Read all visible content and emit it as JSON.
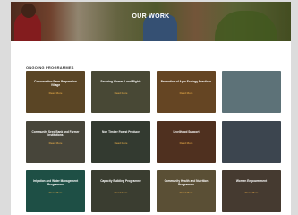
{
  "hero": {
    "title": "OUR WORK"
  },
  "section": {
    "title": "ONGOING PROGRAMMES"
  },
  "cards": [
    {
      "title": "Conservation Farm Preparation Village",
      "sub": "Read More",
      "bg": "#8a6a3a"
    },
    {
      "title": "Securing Women Land Rights",
      "sub": "Read More",
      "bg": "#6f6f52"
    },
    {
      "title": "Promotion of Agro Ecology Practices",
      "sub": "Read More",
      "bg": "#9c6b36"
    },
    {
      "title": "",
      "sub": "",
      "bg": "#8fb0b8"
    },
    {
      "title": "Community Seed Bank and Farmer Institutions",
      "sub": "Read More",
      "bg": "#6e6a5a"
    },
    {
      "title": "Non Timber Forest Produce",
      "sub": "Read More",
      "bg": "#4f5a4a"
    },
    {
      "title": "Livelihood Support",
      "sub": "Read More",
      "bg": "#7a4a30"
    },
    {
      "title": "",
      "sub": "",
      "bg": "#5d6a7a"
    },
    {
      "title": "Irrigation and Water Management Programme",
      "sub": "Read More",
      "bg": "#2f7a6a"
    },
    {
      "title": "Capacity Building Programme",
      "sub": "Read More",
      "bg": "#5a5e4a"
    },
    {
      "title": "Community Health and Nutrition Programme",
      "sub": "Read More",
      "bg": "#8a7a52"
    },
    {
      "title": "Women Empowerment",
      "sub": "Read More",
      "bg": "#6a5a4a"
    }
  ]
}
